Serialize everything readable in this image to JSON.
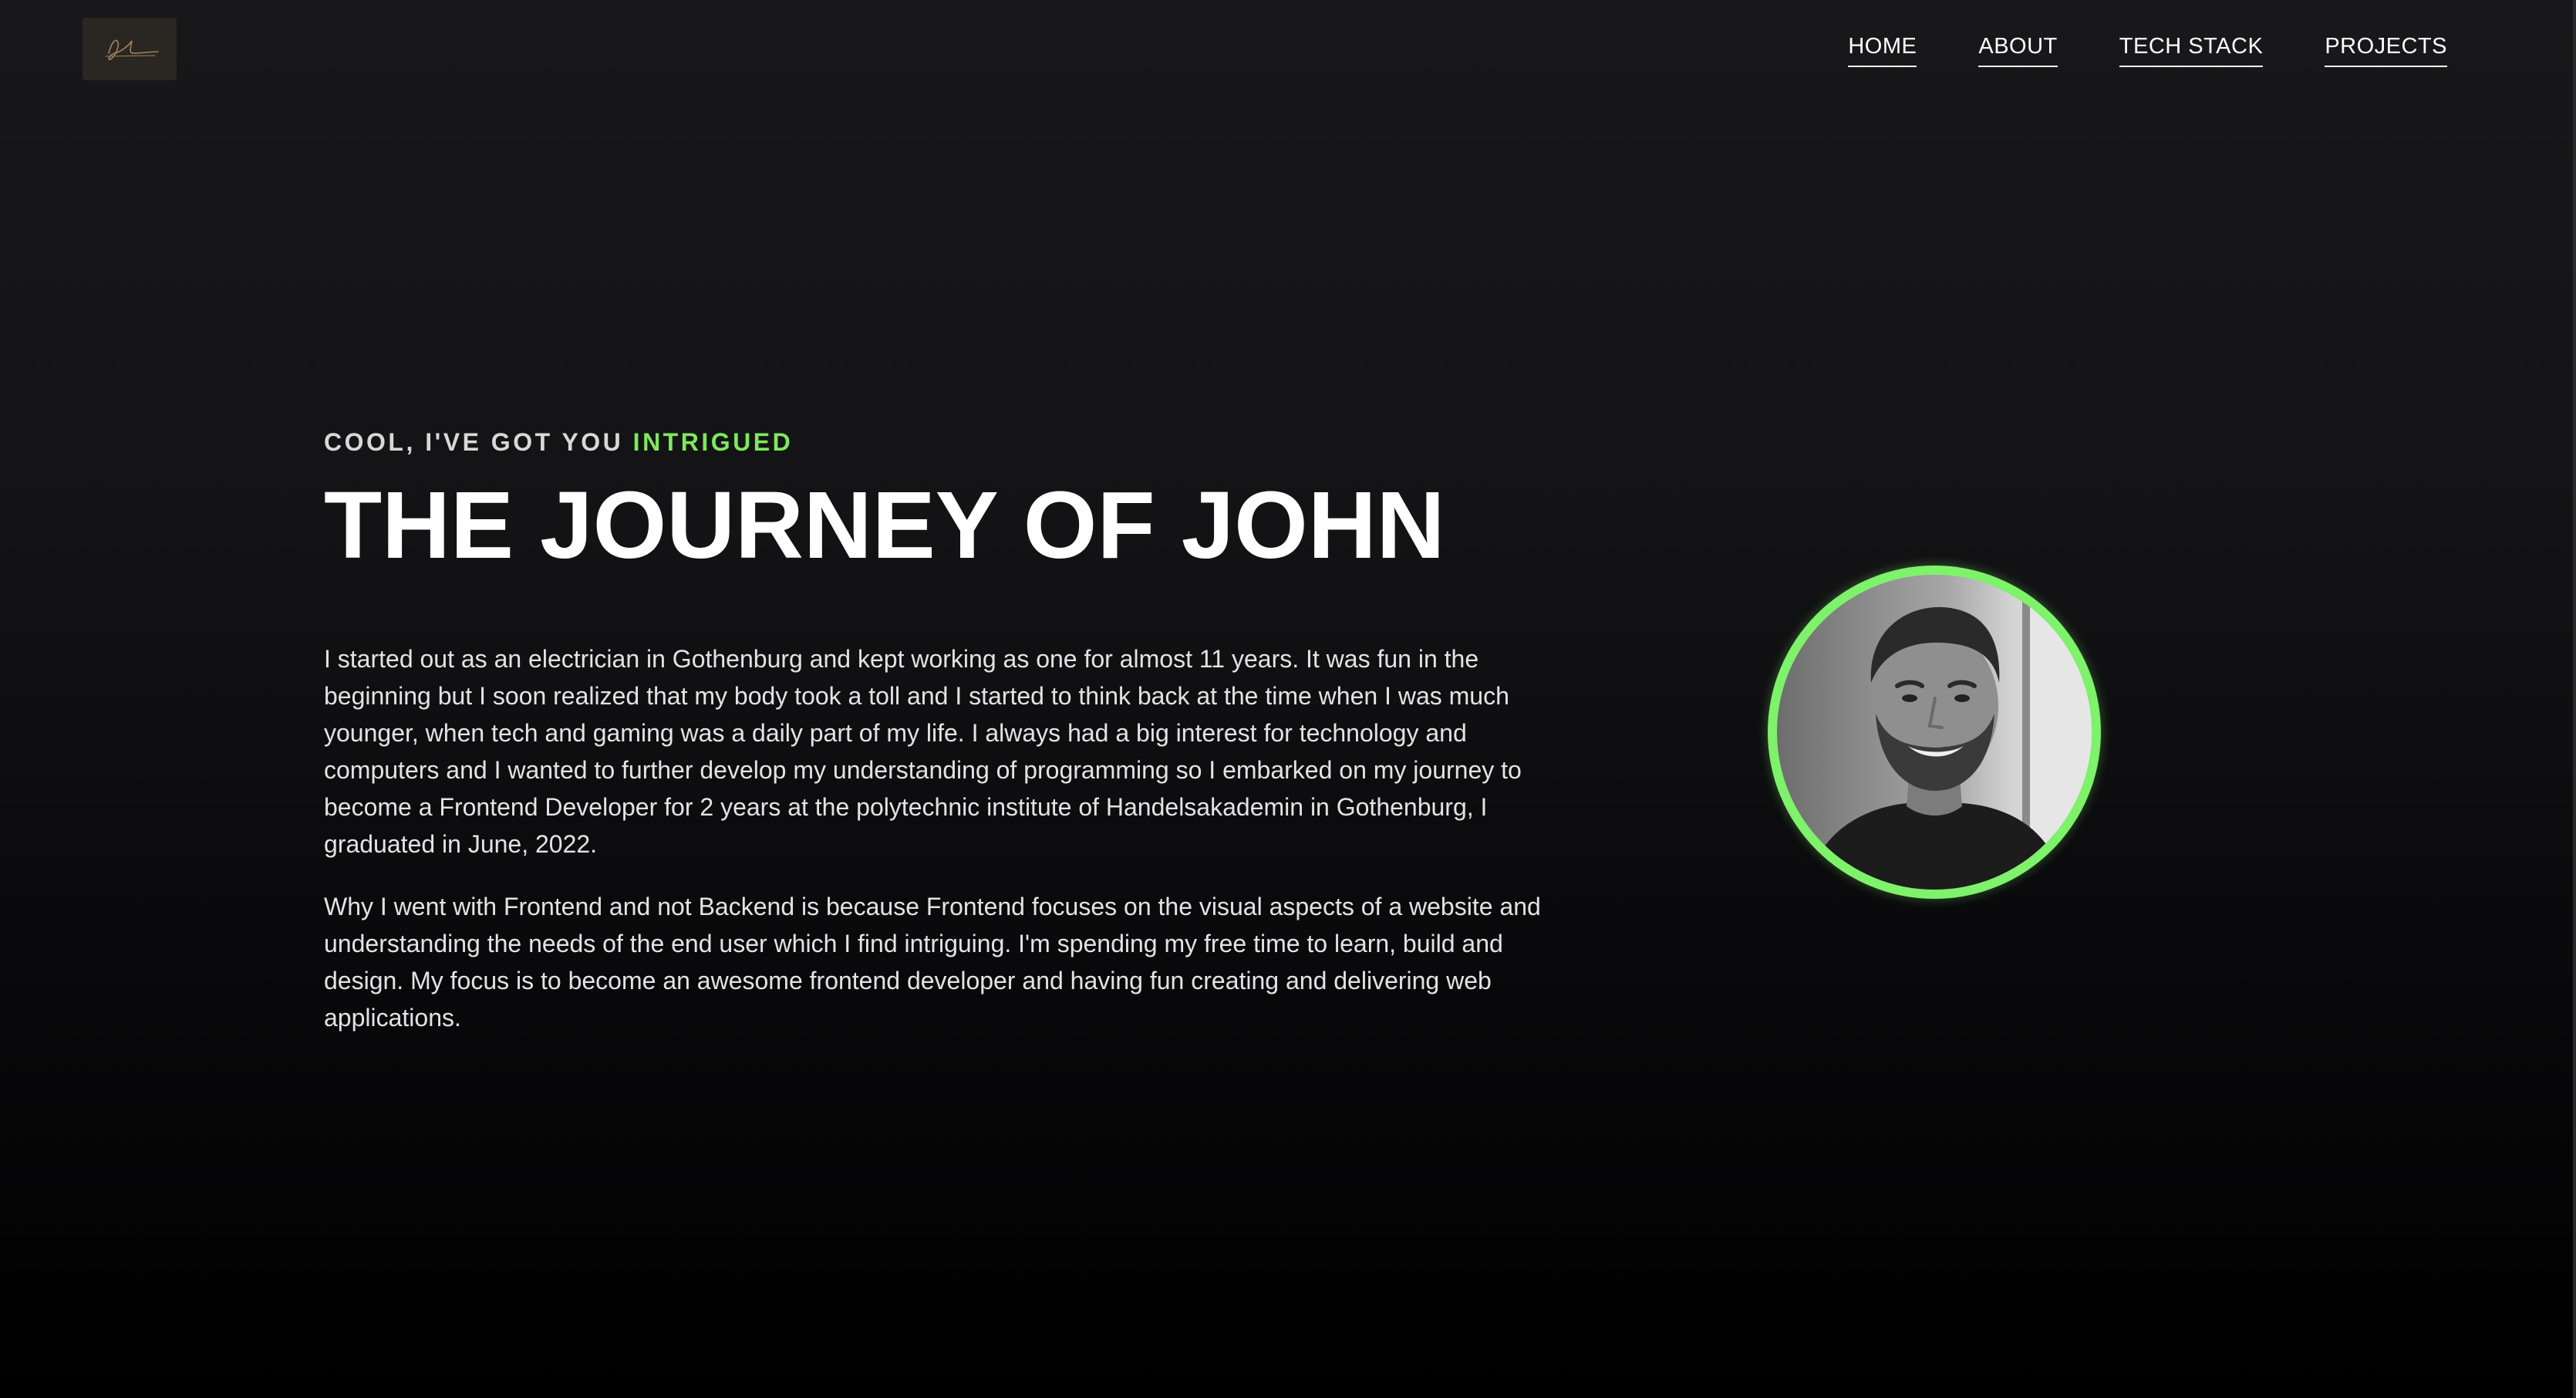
{
  "header": {
    "logo_alt": "signature-logo",
    "nav": [
      {
        "label": "HOME"
      },
      {
        "label": "ABOUT"
      },
      {
        "label": "TECH STACK"
      },
      {
        "label": "PROJECTS"
      }
    ]
  },
  "about": {
    "eyebrow_prefix": "COOL, I'VE GOT YOU ",
    "eyebrow_accent": "INTRIGUED",
    "title": "THE JOURNEY OF JOHN",
    "paragraphs": [
      "I started out as an electrician in Gothenburg and kept working as one for almost 11 years. It was fun in the beginning but I soon realized that my body took a toll and I started to think back at the time when I was much younger, when tech and gaming was a daily part of my life. I always had a big interest for technology and computers and I wanted to further develop my understanding of programming so I embarked on my journey to become a Frontend Developer for 2 years at the polytechnic institute of Handelsakademin in Gothenburg, I graduated in June, 2022.",
      "Why I went with Frontend and not Backend is because Frontend focuses on the visual aspects of a website and understanding the needs of the end user which I find intriguing. I'm spending my free time to learn, build and design. My focus is to become an awesome frontend developer and having fun creating and delivering web applications."
    ]
  },
  "colors": {
    "accent": "#7ee95c",
    "ring": "#7ef26a",
    "background_top": "#18181b",
    "background_bottom": "#000000"
  }
}
